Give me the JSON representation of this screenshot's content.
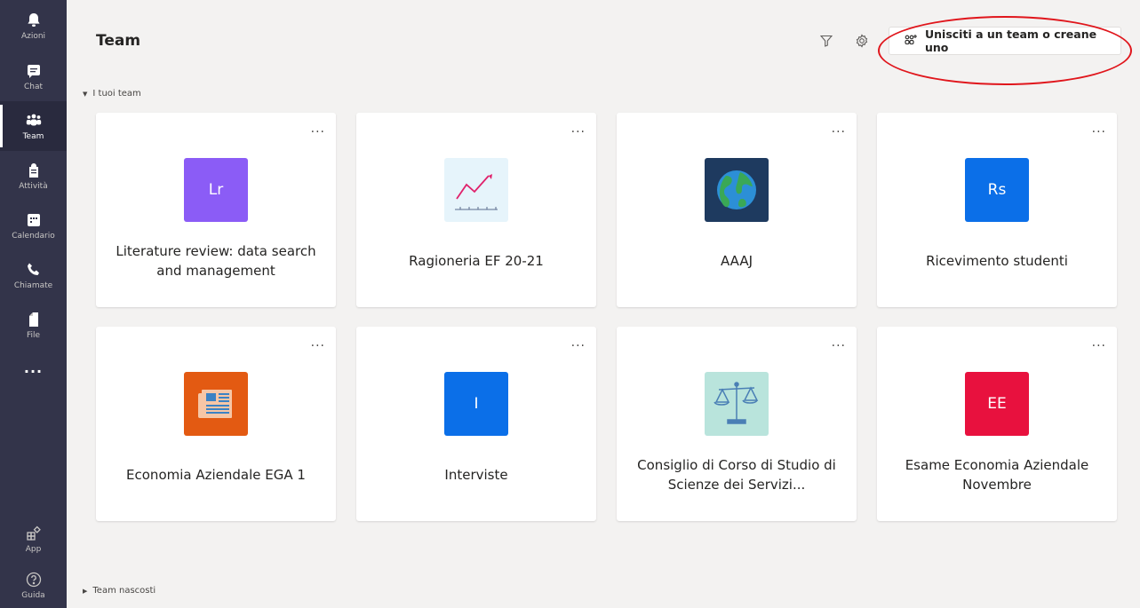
{
  "rail": {
    "items": [
      {
        "label": "Azioni",
        "icon": "bell-icon"
      },
      {
        "label": "Chat",
        "icon": "chat-icon"
      },
      {
        "label": "Team",
        "icon": "teams-icon"
      },
      {
        "label": "Attività",
        "icon": "assignments-icon"
      },
      {
        "label": "Calendario",
        "icon": "calendar-icon"
      },
      {
        "label": "Chiamate",
        "icon": "phone-icon"
      },
      {
        "label": "File",
        "icon": "file-icon"
      }
    ],
    "more": "...",
    "bottom": [
      {
        "label": "App",
        "icon": "apps-icon"
      },
      {
        "label": "Guida",
        "icon": "help-icon"
      }
    ]
  },
  "header": {
    "title": "Team",
    "join_button": "Unisciti a un team o creane uno"
  },
  "sections": {
    "your_teams": "I tuoi team",
    "hidden_teams": "Team nascosti"
  },
  "teams": [
    {
      "name": "Literature review: data search and management",
      "tile_text": "Lr",
      "tile_color": "#8b5cf6",
      "icon": "initials-tile"
    },
    {
      "name": "Ragioneria EF 20-21",
      "tile_text": "",
      "tile_color": "#e6f4fb",
      "icon": "chart-trend-icon"
    },
    {
      "name": "AAAJ",
      "tile_text": "",
      "tile_color": "#1e3a5f",
      "icon": "globe-icon"
    },
    {
      "name": "Ricevimento studenti",
      "tile_text": "Rs",
      "tile_color": "#0b6fe8",
      "icon": "initials-tile"
    },
    {
      "name": "Economia Aziendale EGA 1",
      "tile_text": "",
      "tile_color": "#e35a12",
      "icon": "newspaper-icon"
    },
    {
      "name": "Interviste",
      "tile_text": "I",
      "tile_color": "#0b6fe8",
      "icon": "initials-tile"
    },
    {
      "name": "Consiglio di Corso di Studio di Scienze dei Servizi...",
      "tile_text": "",
      "tile_color": "#b9e4dc",
      "icon": "scales-icon"
    },
    {
      "name": "Esame Economia Aziendale Novembre",
      "tile_text": "EE",
      "tile_color": "#e8113e",
      "icon": "initials-tile"
    }
  ],
  "card_more": "...",
  "colors": {
    "rail_bg": "#33344a",
    "accent": "#6264a7",
    "highlight": "#e0161c"
  }
}
